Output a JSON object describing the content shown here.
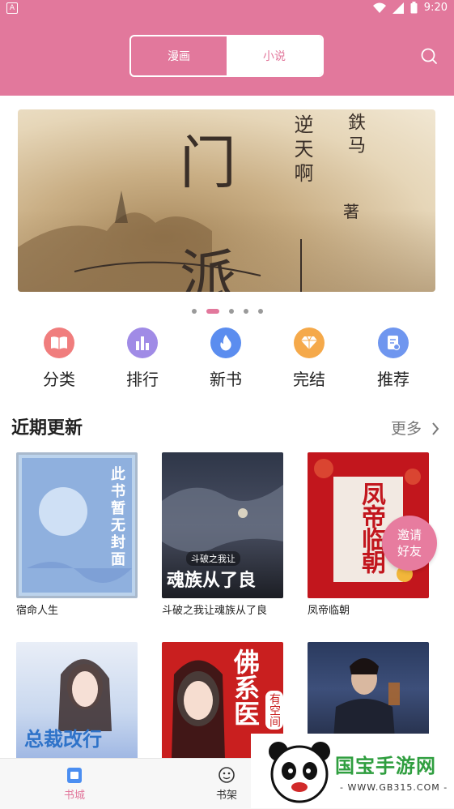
{
  "status_bar": {
    "left_icon": "A",
    "time": "9:20"
  },
  "header": {
    "tabs": [
      {
        "label": "漫画",
        "active": false
      },
      {
        "label": "小说",
        "active": true
      }
    ]
  },
  "banner": {
    "big_chars": [
      "门",
      "派"
    ],
    "title_vertical": "逆天啊",
    "author": "鉄马",
    "author_mark": "著"
  },
  "carousel": {
    "count": 5,
    "active_index": 1
  },
  "categories": [
    {
      "label": "分类",
      "icon": "book-icon",
      "color": "#f07d7d"
    },
    {
      "label": "排行",
      "icon": "bar-chart-icon",
      "color": "#a08be6"
    },
    {
      "label": "新书",
      "icon": "flame-icon",
      "color": "#5b8def"
    },
    {
      "label": "完结",
      "icon": "diamond-icon",
      "color": "#f5a94a"
    },
    {
      "label": "推荐",
      "icon": "document-icon",
      "color": "#6f96ef"
    }
  ],
  "section": {
    "title": "近期更新",
    "more": "更多"
  },
  "books": [
    {
      "title": "宿命人生",
      "cover_text": "此书暂无封面"
    },
    {
      "title": "斗破之我让魂族从了良",
      "cover_text": "魂族从了良",
      "cover_sub": "斗破之我让"
    },
    {
      "title": "凤帝临朝",
      "cover_text": "凤帝临朝"
    },
    {
      "title": "",
      "cover_text": "总裁改行"
    },
    {
      "title": "",
      "cover_text": "佛系医",
      "cover_sub": "有空间"
    },
    {
      "title": "",
      "cover_text": ""
    }
  ],
  "invite": {
    "line1": "邀请",
    "line2": "好友"
  },
  "bottom_nav": [
    {
      "label": "书城",
      "active": true
    },
    {
      "label": "书架",
      "active": false
    }
  ],
  "watermark": {
    "text": "国宝手游网",
    "url": "- WWW.GB315.COM -"
  },
  "colors": {
    "accent": "#e2789c"
  }
}
